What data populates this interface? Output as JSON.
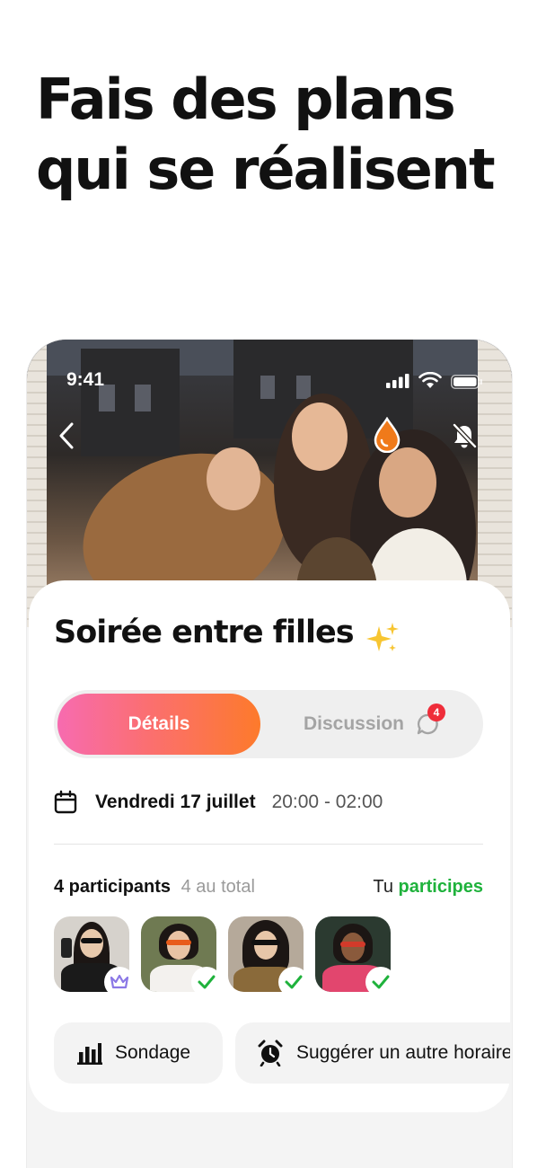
{
  "headline": {
    "line1": "Fais des plans",
    "line2": "qui se réalisent"
  },
  "status_bar": {
    "time": "9:41"
  },
  "event": {
    "title": "Soirée entre filles"
  },
  "tabs": {
    "details": "Détails",
    "discussion": "Discussion",
    "discussion_badge": "4"
  },
  "date": {
    "label": "Vendredi 17 juillet",
    "time": "20:00 - 02:00"
  },
  "participants": {
    "count_label": "4 participants",
    "total_label": "4 au total",
    "status_prefix": "Tu",
    "status_value": "participes",
    "avatars": [
      {
        "name": "participant-1",
        "badge": "crown-icon"
      },
      {
        "name": "participant-2",
        "badge": "check-icon"
      },
      {
        "name": "participant-3",
        "badge": "check-icon"
      },
      {
        "name": "participant-4",
        "badge": "check-icon"
      }
    ]
  },
  "actions": {
    "poll": "Sondage",
    "suggest_time": "Suggérer un autre horaire"
  },
  "colors": {
    "gradient_start": "#f76bb0",
    "gradient_end": "#fd7a2b",
    "accent_green": "#1fb23c",
    "badge_red": "#ef2d3a",
    "crown_purple": "#8b78e6",
    "drop_orange": "#f07a1a"
  }
}
